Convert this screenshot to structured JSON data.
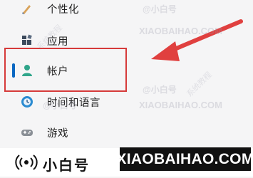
{
  "nav": {
    "items": [
      {
        "label": "个性化",
        "icon": "paintbrush-icon"
      },
      {
        "label": "应用",
        "icon": "apps-icon"
      },
      {
        "label": "帐户",
        "icon": "account-icon",
        "selected": true
      },
      {
        "label": "时间和语言",
        "icon": "clock-globe-icon"
      },
      {
        "label": "游戏",
        "icon": "gamepad-icon"
      },
      {
        "label": "",
        "icon": "accessibility-icon"
      }
    ]
  },
  "watermark": {
    "text": "XIAOBAIHAO.COM",
    "handle": "@小白号",
    "side_text": "系统教程"
  },
  "footer": {
    "brand": "小白号",
    "domain": "XIAOBAIHAO.COM"
  },
  "colors": {
    "accent": "#0a67c2",
    "highlight": "#d63a3a",
    "arrow": "#e0403f"
  }
}
